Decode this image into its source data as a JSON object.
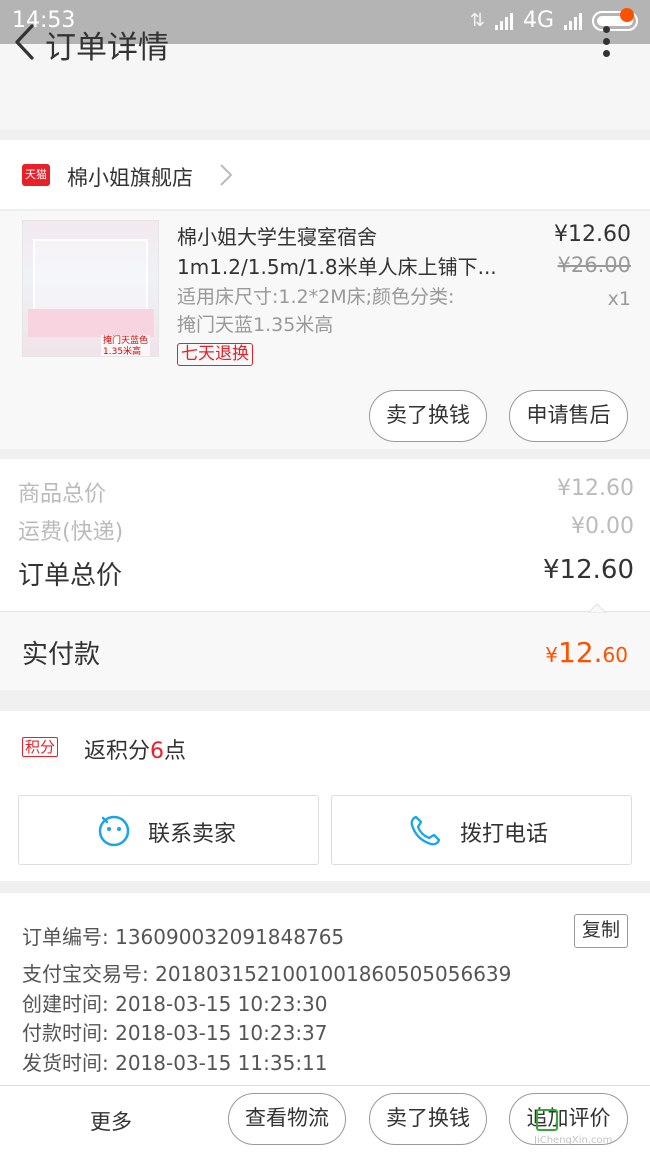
{
  "status_bar": {
    "time": "14:53",
    "network": "4G"
  },
  "nav": {
    "title": "订单详情"
  },
  "shop": {
    "badge": "天猫",
    "name": "棉小姐旗舰店"
  },
  "item": {
    "title_line1": "棉小姐大学生寝室宿舍",
    "title_line2": "1m1.2/1.5m/1.8米单人床上铺下...",
    "spec_line1": "适用床尺寸:1.2*2M床;颜色分类:",
    "spec_line2": "掩门天蓝1.35米高",
    "return_tag": "七天退换",
    "price": "¥12.60",
    "original_price": "¥26.00",
    "quantity": "x1",
    "thumb_label_line1": "掩门天蓝色",
    "thumb_label_line2": "1.35米高",
    "buttons": {
      "exchange": "卖了换钱",
      "after_sale": "申请售后"
    }
  },
  "totals": {
    "goods_label": "商品总价",
    "goods_value": "¥12.60",
    "shipping_label": "运费(快递)",
    "shipping_value": "¥0.00",
    "order_label": "订单总价",
    "order_value": "¥12.60"
  },
  "paid": {
    "label": "实付款",
    "currency": "¥",
    "amount_main": "12.",
    "amount_small": "60"
  },
  "points": {
    "badge": "积分",
    "text_prefix": "返积分",
    "num": "6",
    "text_suffix": "点"
  },
  "contact": {
    "seller": "联系卖家",
    "phone": "拨打电话"
  },
  "info": {
    "order_no": "订单编号: 1360900320918487​65",
    "alipay_no": "支付宝交易号: 2018031521001001860505056639",
    "created": "创建时间: 2018-03-15 10:23:30",
    "paid": "付款时间: 2018-03-15 10:23:37",
    "shipped": "发货时间: 2018-03-15 11:35:11",
    "copy": "复制"
  },
  "bottom": {
    "more": "更多",
    "logistics": "查看物流",
    "exchange": "卖了换钱",
    "review": "追加评价"
  },
  "watermark": {
    "site": "JiChengXin.com"
  },
  "colors": {
    "accent": "#ff5000",
    "tmall_red": "#e8202a",
    "status_bar": "#b4b4b4"
  }
}
